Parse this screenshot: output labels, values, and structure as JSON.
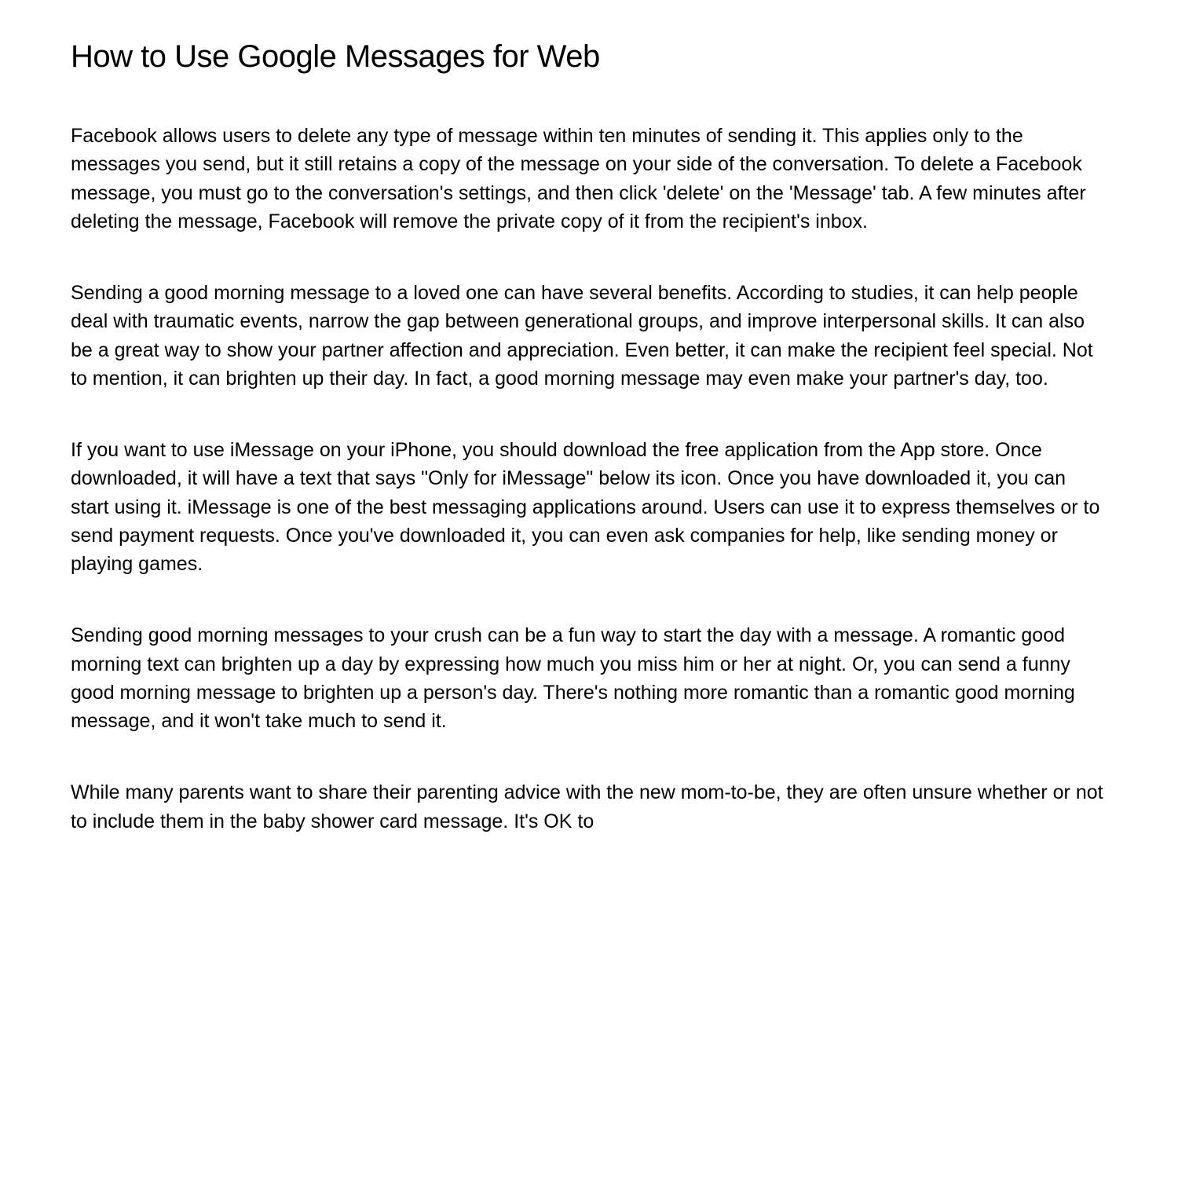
{
  "title": "How to Use Google Messages for Web",
  "paragraphs": [
    "Facebook allows users to delete any type of message within ten minutes of sending it. This applies only to the messages you send, but it still retains a copy of the message on your side of the conversation. To delete a Facebook message, you must go to the conversation's settings, and then click 'delete' on the 'Message' tab. A few minutes after deleting the message, Facebook will remove the private copy of it from the recipient's inbox.",
    "Sending a good morning message to a loved one can have several benefits. According to studies, it can help people deal with traumatic events, narrow the gap between generational groups, and improve interpersonal skills. It can also be a great way to show your partner affection and appreciation. Even better, it can make the recipient feel special. Not to mention, it can brighten up their day. In fact, a good morning message may even make your partner's day, too.",
    "If you want to use iMessage on your iPhone, you should download the free application from the App store. Once downloaded, it will have a text that says \"Only for iMessage\" below its icon. Once you have downloaded it, you can start using it. iMessage is one of the best messaging applications around. Users can use it to express themselves or to send payment requests. Once you've downloaded it, you can even ask companies for help, like sending money or playing games.",
    "Sending good morning messages to your crush can be a fun way to start the day with a message. A romantic good morning text can brighten up a day by expressing how much you miss him or her at night. Or, you can send a funny good morning message to brighten up a person's day. There's nothing more romantic than a romantic good morning message, and it won't take much to send it.",
    "While many parents want to share their parenting advice with the new mom-to-be, they are often unsure whether or not to include them in the baby shower card message. It's OK to"
  ]
}
